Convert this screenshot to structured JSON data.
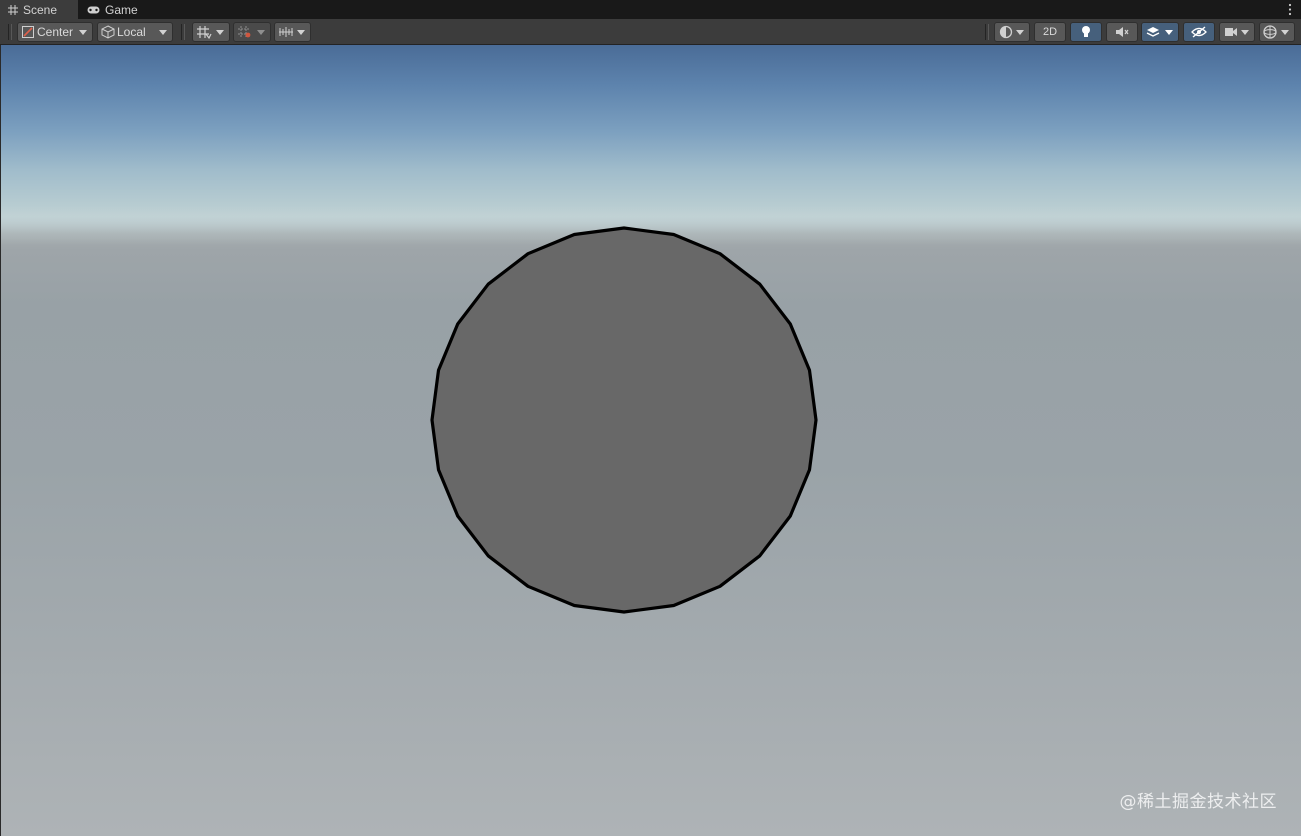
{
  "tabs": [
    {
      "label": "Scene",
      "icon": "grid-icon",
      "active": true
    },
    {
      "label": "Game",
      "icon": "gamepad-icon",
      "active": false
    }
  ],
  "toolbar": {
    "pivot_mode_label": "Center",
    "pivot_rotation_label": "Local",
    "toggle_2d_label": "2D",
    "lighting_enabled": true,
    "scene_visibility_enabled": true
  },
  "scene": {
    "object": "sphere",
    "sphere_color": "#686868",
    "outline_color": "#000000"
  },
  "watermark": "@稀土掘金技术社区",
  "colors": {
    "editor_bg": "#3c3c3c",
    "button_bg": "#585858",
    "active_button_bg": "#46607c",
    "sky_top": "#4a6c97",
    "ground": "#9ea5a9"
  }
}
